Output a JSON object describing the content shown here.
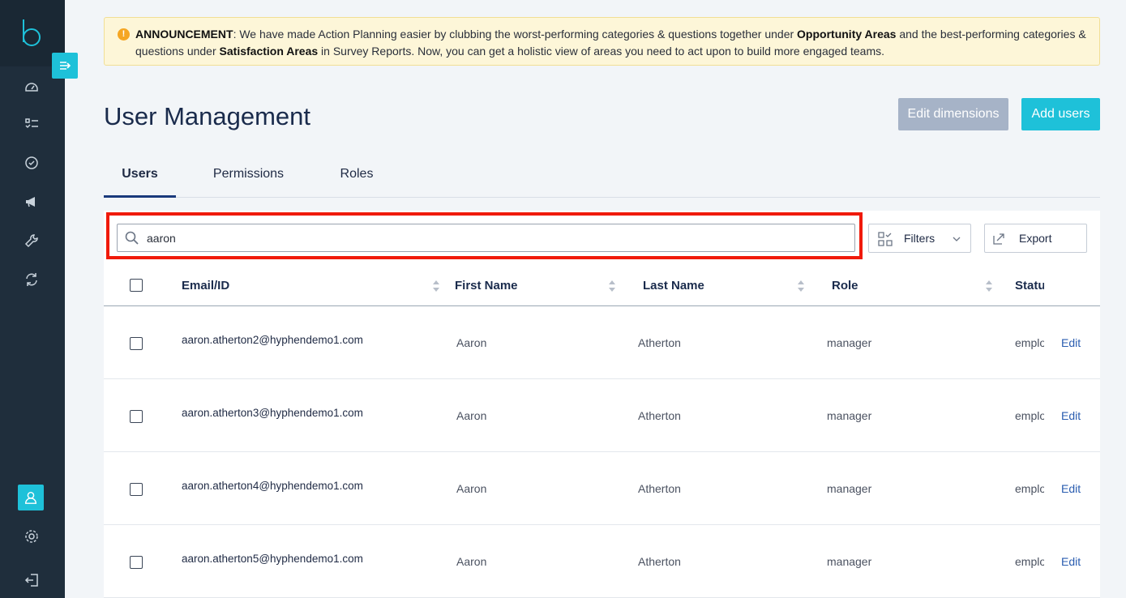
{
  "announcement": {
    "label": "ANNOUNCEMENT",
    "text1": ": We have made Action Planning easier by clubbing the worst-performing categories & questions  together under ",
    "bold1": "Opportunity Areas",
    "text2": " and the best-performing  categories & questions under ",
    "bold2": "Satisfaction Areas",
    "text3": " in Survey Reports.  Now, you can get a holistic view of areas you need to act upon to build more engaged teams."
  },
  "page": {
    "title": "User Management",
    "edit_dimensions": "Edit dimensions",
    "add_users": "Add users"
  },
  "tabs": [
    "Users",
    "Permissions",
    "Roles"
  ],
  "search": {
    "value": "aaron"
  },
  "controls": {
    "filters": "Filters",
    "export": "Export"
  },
  "table": {
    "headers": [
      "Email/ID",
      "First Name",
      "Last Name",
      "Role",
      "Status"
    ],
    "edit_label": "Edit",
    "rows": [
      {
        "email": "aaron.atherton2@hyphendemo1.com",
        "first": "Aaron",
        "last": "Atherton",
        "role": "manager",
        "status": "employee"
      },
      {
        "email": "aaron.atherton3@hyphendemo1.com",
        "first": "Aaron",
        "last": "Atherton",
        "role": "manager",
        "status": "employee"
      },
      {
        "email": "aaron.atherton4@hyphendemo1.com",
        "first": "Aaron",
        "last": "Atherton",
        "role": "manager",
        "status": "employee"
      },
      {
        "email": "aaron.atherton5@hyphendemo1.com",
        "first": "Aaron",
        "last": "Atherton",
        "role": "manager",
        "status": "employee"
      }
    ]
  },
  "colors": {
    "accent": "#1ec1d9",
    "sidebar": "#1f2e3c",
    "highlight": "#f01a0a",
    "link": "#2a5db0"
  },
  "icons": [
    "logo-b-icon",
    "collapse-icon",
    "dashboard-icon",
    "checklist-icon",
    "check-circle-icon",
    "megaphone-icon",
    "wrench-icon",
    "sync-icon",
    "user-icon",
    "gear-icon",
    "logout-icon"
  ]
}
